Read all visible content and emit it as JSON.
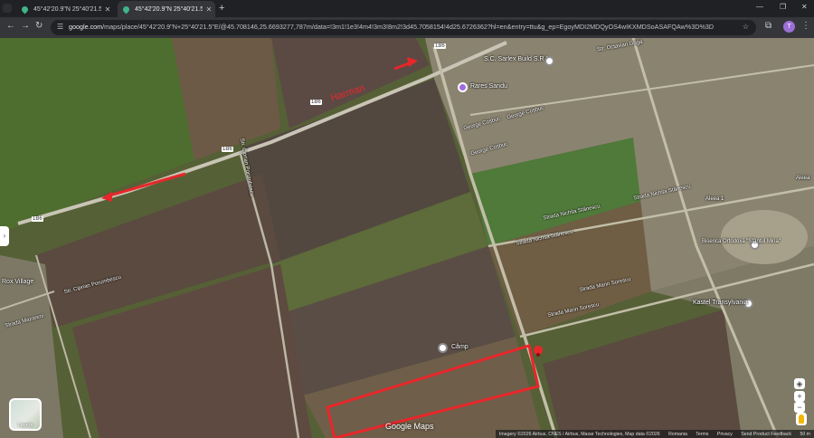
{
  "browser": {
    "tabs": [
      {
        "title": "45°42'20.9\"N 25°40'21.5\"E - Go",
        "active": false
      },
      {
        "title": "45°42'20.9\"N 25°40'21.5\"E - Go",
        "active": true
      }
    ],
    "new_tab": "+",
    "window_controls": {
      "minimize": "—",
      "maximize": "❐",
      "close": "✕"
    },
    "url_host": "google.com",
    "url_path": "/maps/place/45°42'20.9\"N+25°40'21.5\"E/@45.708146,25.6693277,787m/data=!3m1!1e3!4m4!3m3!8m2!3d45.7058154!4d25.6726362?hl=en&entry=ttu&g_ep=EgoyMDI2MDQyOS4wIKXMDSoASAFQAw%3D%3D",
    "profile_initial": "T",
    "colors": {
      "chrome_bg": "#202124",
      "toolbar_bg": "#35363a",
      "profile": "#9b6fd6"
    }
  },
  "map": {
    "type": "satellite",
    "annotations": {
      "arrow_color": "#e8262a",
      "outline_color": "#e8262a"
    },
    "labels": {
      "harman_annotation": "Harman",
      "place_sarlex": "S.C. Sarlex Build S.R.L.",
      "place_rares": "Rares Sandu",
      "street_coshuc_1": "George Coșbuc",
      "street_coshuc_2": "George Coșbuc",
      "street_coshuc_3": "George Coșbuc",
      "place_camp": "Câmp",
      "place_church": "Biserica Ortodoxă \"Sfântul Mina\"",
      "place_kastel": "Kastel Transylvania",
      "place_village": "Rox Village",
      "street_ciprian_1": "Str. Ciprian Porumbescu",
      "street_ciprian_2": "Str. Ciprian Porumbescu",
      "street_nichita_1": "Strada Nichita Stănescu",
      "street_nichita_2": "Strada Nichita Stănescu",
      "street_nichita_3": "Strada Nichita Stănescu",
      "street_marin_1": "Strada Marin Sorescu",
      "street_marin_2": "Strada Marin Sorescu",
      "street_aleea_1": "Aleea 1",
      "street_aleea_2": "Aleea",
      "street_octavian": "Str. Octavian Goga",
      "street_mazareni": "Strada Mazareni",
      "road_shield": "1B6"
    },
    "layers_label": "Layers",
    "logo_text": "Google Maps",
    "attribution": {
      "imagery": "Imagery ©2026 Airbus, CNES / Airbus, Maxar Technologies, Map data ©2026",
      "language": "Romania",
      "terms": "Terms",
      "privacy": "Privacy",
      "feedback": "Send Product Feedback",
      "scale": "50 m"
    },
    "controls": {
      "zoom_in": "+",
      "zoom_out": "−",
      "compass": "◈",
      "side_toggle": "›"
    }
  }
}
